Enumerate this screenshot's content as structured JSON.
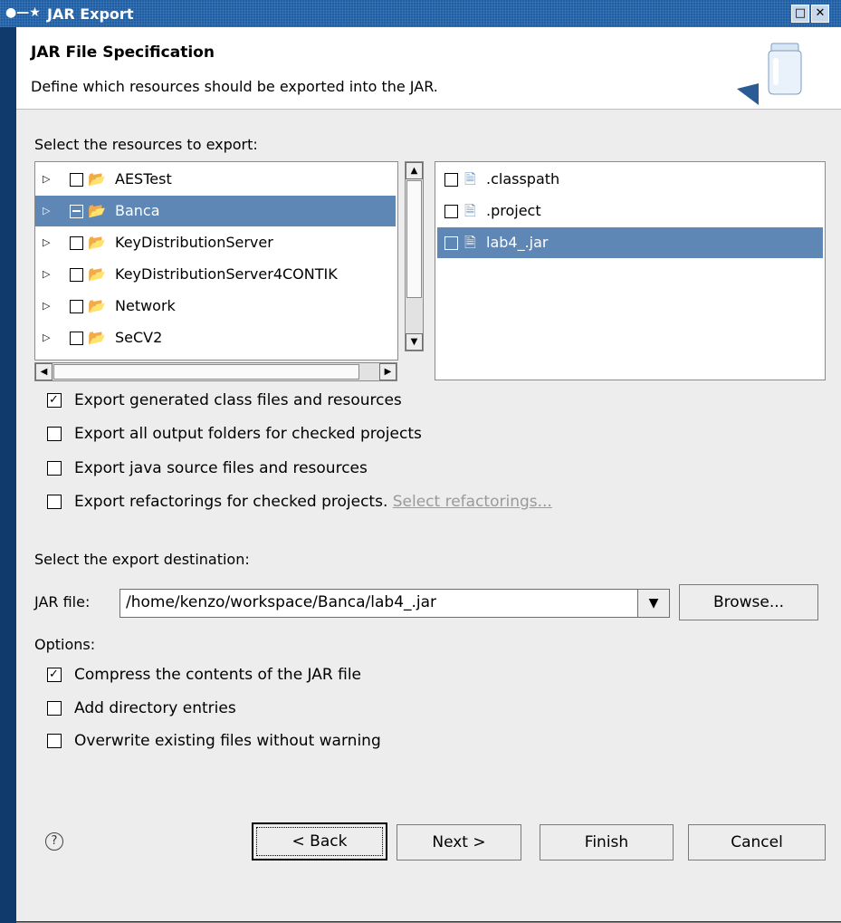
{
  "window": {
    "title": "JAR Export"
  },
  "header": {
    "title": "JAR File Specification",
    "description": "Define which resources should be exported into the JAR."
  },
  "resources": {
    "label": "Select the resources to export:",
    "projects": [
      {
        "name": "AESTest",
        "checked": false,
        "selected": false
      },
      {
        "name": "Banca",
        "checked": "partial",
        "selected": true
      },
      {
        "name": "KeyDistributionServer",
        "checked": false,
        "selected": false
      },
      {
        "name": "KeyDistributionServer4CONTIK",
        "checked": false,
        "selected": false
      },
      {
        "name": "Network",
        "checked": false,
        "selected": false
      },
      {
        "name": "SeCV2",
        "checked": false,
        "selected": false
      }
    ],
    "files": [
      {
        "name": ".classpath",
        "checked": false,
        "selected": false
      },
      {
        "name": ".project",
        "checked": false,
        "selected": false
      },
      {
        "name": "lab4_.jar",
        "checked": false,
        "selected": true
      }
    ]
  },
  "export_options": [
    {
      "label": "Export generated class files and resources",
      "checked": true
    },
    {
      "label": "Export all output folders for checked projects",
      "checked": false
    },
    {
      "label": "Export java source files and resources",
      "checked": false
    },
    {
      "label": "Export refactorings for checked projects.",
      "checked": false,
      "link": "Select refactorings..."
    }
  ],
  "destination": {
    "label": "Select the export destination:",
    "jar_label": "JAR file:",
    "jar_value": "/home/kenzo/workspace/Banca/lab4_.jar",
    "browse_label": "Browse..."
  },
  "options": {
    "label": "Options:",
    "items": [
      {
        "label": "Compress the contents of the JAR file",
        "checked": true
      },
      {
        "label": "Add directory entries",
        "checked": false
      },
      {
        "label": "Overwrite existing files without warning",
        "checked": false
      }
    ]
  },
  "buttons": {
    "back": "< Back",
    "next": "Next >",
    "finish": "Finish",
    "cancel": "Cancel"
  },
  "colors": {
    "selection": "#5f87b5",
    "titlebar": "#1f5fa6",
    "dialog_bg": "#ededed"
  }
}
